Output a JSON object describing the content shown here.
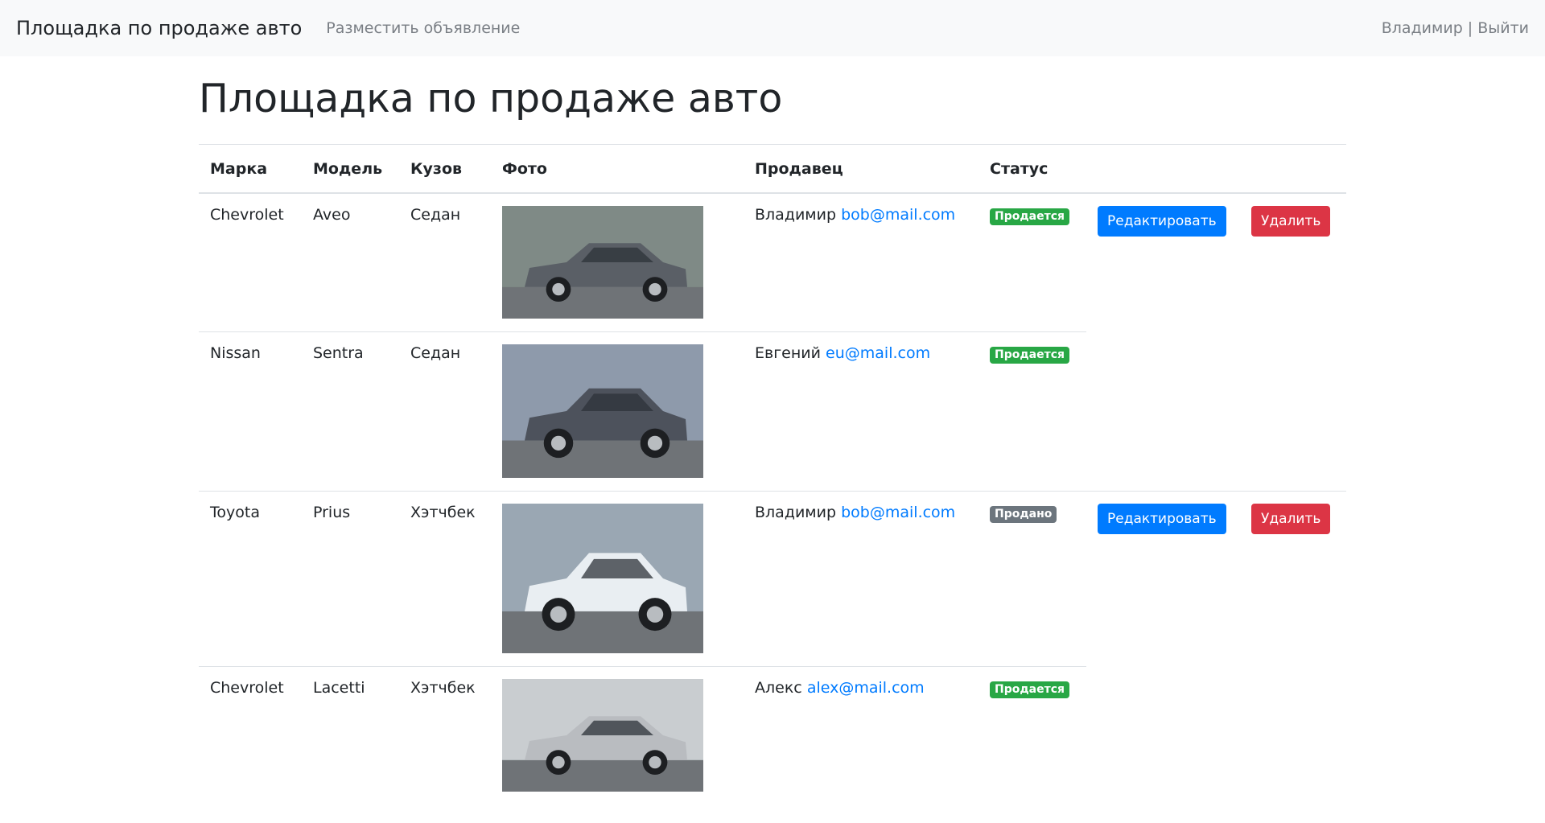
{
  "navbar": {
    "brand": "Площадка по продаже авто",
    "post_ad": "Разместить объявление",
    "user": "Владимир",
    "separator": "|",
    "logout": "Выйти"
  },
  "page": {
    "title": "Площадка по продаже авто"
  },
  "table": {
    "headers": [
      "Марка",
      "Модель",
      "Кузов",
      "Фото",
      "Продавец",
      "Статус"
    ],
    "rows": [
      {
        "brand": "Chevrolet",
        "model": "Aveo",
        "body": "Седан",
        "seller_name": "Владимир",
        "seller_email": "bob@mail.com",
        "status": "Продается",
        "status_color": "#28a745",
        "photo_bg": "#7f8a86",
        "car_color": "#5a5f66",
        "edit_label": "Редактировать",
        "delete_label": "Удалить"
      },
      {
        "brand": "Nissan",
        "model": "Sentra",
        "body": "Седан",
        "seller_name": "Евгений",
        "seller_email": "eu@mail.com",
        "status": "Продается",
        "status_color": "#28a745",
        "photo_bg": "#8e9aab",
        "car_color": "#4d525c"
      },
      {
        "brand": "Toyota",
        "model": "Prius",
        "body": "Хэтчбек",
        "seller_name": "Владимир",
        "seller_email": "bob@mail.com",
        "status": "Продано",
        "status_color": "#6c757d",
        "photo_bg": "#9aa7b3",
        "car_color": "#e9eef2",
        "edit_label": "Редактировать",
        "delete_label": "Удалить"
      },
      {
        "brand": "Chevrolet",
        "model": "Lacetti",
        "body": "Хэтчбек",
        "seller_name": "Алекс",
        "seller_email": "alex@mail.com",
        "status": "Продается",
        "status_color": "#28a745",
        "photo_bg": "#c9cdd0",
        "car_color": "#b9bcc0"
      }
    ]
  }
}
